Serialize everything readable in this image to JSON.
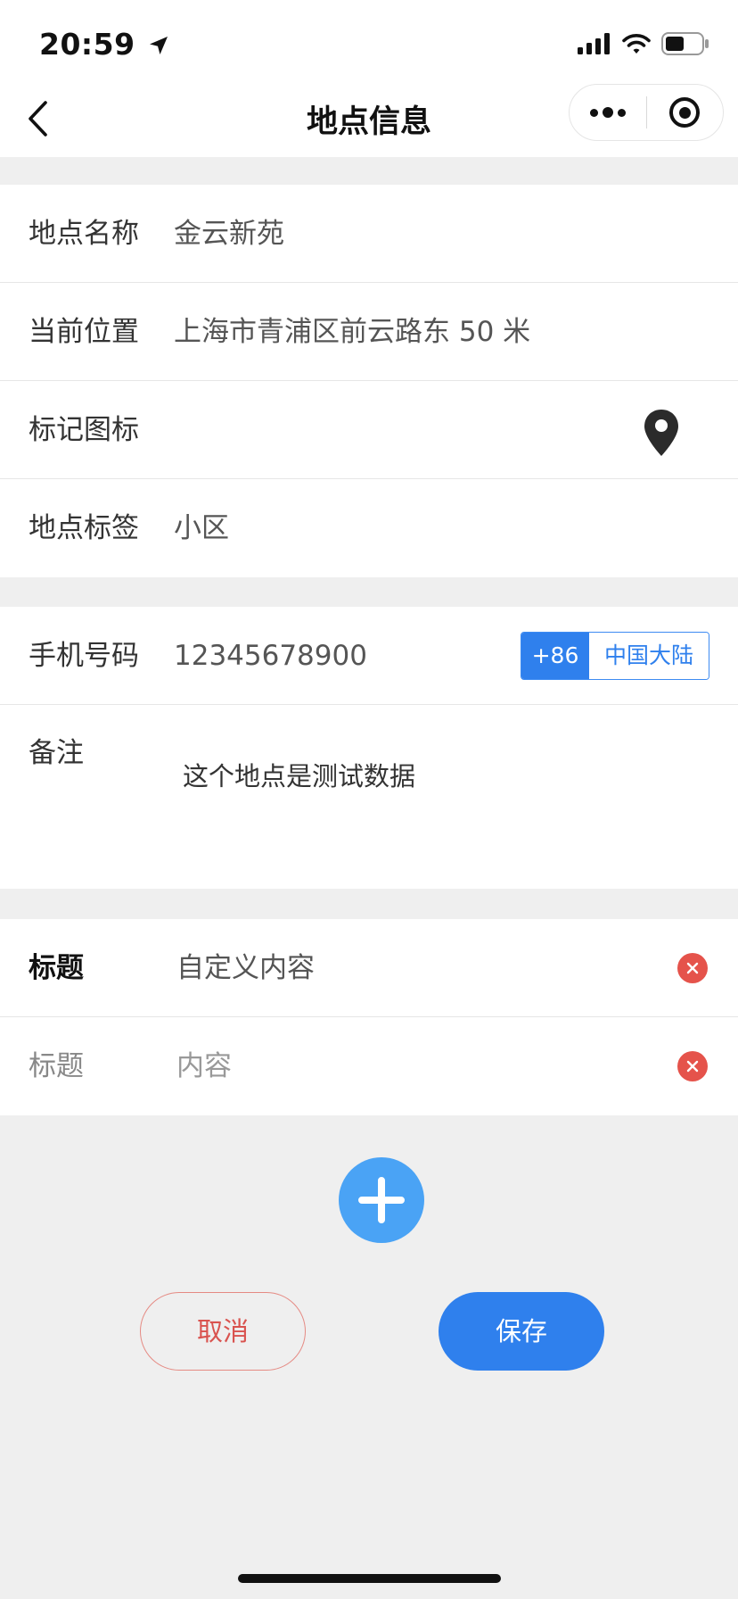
{
  "status_bar": {
    "time": "20:59"
  },
  "nav": {
    "title": "地点信息"
  },
  "location": {
    "name_label": "地点名称",
    "name_value": "金云新苑",
    "position_label": "当前位置",
    "position_value": "上海市青浦区前云路东 50 米",
    "icon_label": "标记图标",
    "tag_label": "地点标签",
    "tag_value": "小区"
  },
  "contact": {
    "phone_label": "手机号码",
    "phone_value": "12345678900",
    "country_code": "+86",
    "region": "中国大陆",
    "note_label": "备注",
    "note_value": "这个地点是测试数据"
  },
  "custom_fields": [
    {
      "label": "标题",
      "value": "自定义内容"
    },
    {
      "label": "标题",
      "value": "内容"
    }
  ],
  "actions": {
    "cancel": "取消",
    "save": "保存"
  },
  "colors": {
    "primary": "#2f80ed",
    "danger": "#e5534b",
    "add": "#4aa3f5",
    "background": "#efefef"
  }
}
